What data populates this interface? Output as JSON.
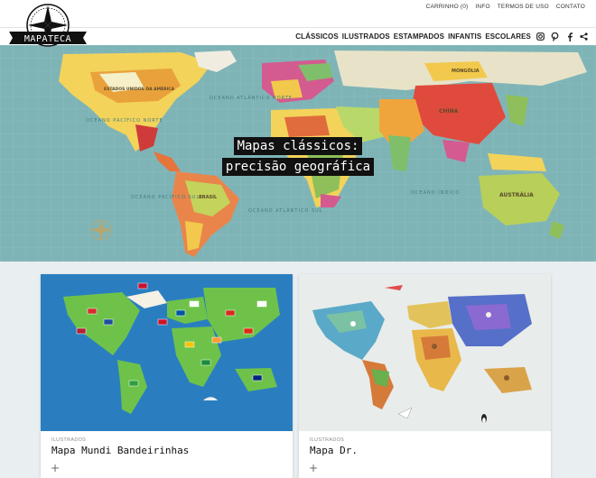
{
  "brand": {
    "logo_text": "MAPATECA"
  },
  "top_links": [
    "CARRINHO (0)",
    "INFO",
    "TERMOS DE USO",
    "CONTATO"
  ],
  "nav": [
    "CLÁSSICOS",
    "ILUSTRADOS",
    "ESTAMPADOS",
    "INFANTIS",
    "ESCOLARES"
  ],
  "social_icons": [
    "instagram-icon",
    "pinterest-icon",
    "facebook-icon",
    "share-icon"
  ],
  "hero": {
    "line1": "Mapas clássicos:",
    "line2": "precisão geográfica",
    "map_labels": [
      "OCEANO PACÍFICO NORTE",
      "OCEANO ATLÂNTICO NORTE",
      "OCEANO ÍNDICO",
      "OCEANO PACÍFICO SUL",
      "OCEANO ATLÂNTICO SUL",
      "AUSTRÁLIA",
      "CHINA",
      "MONGÓLIA",
      "ESTADOS UNIDOS DA AMÉRICA",
      "BRASIL"
    ]
  },
  "cards": [
    {
      "category": "ILUSTRADOS",
      "name": "Mapa Mundi Bandeirinhas",
      "plus": "+"
    },
    {
      "category": "ILUSTRADOS",
      "name": "Mapa Dr.",
      "plus": "+"
    }
  ],
  "colors": {
    "ocean": "#7fb4b7",
    "card2_bg": "#e8ecea",
    "card1_bg": "#2a7ec0"
  }
}
